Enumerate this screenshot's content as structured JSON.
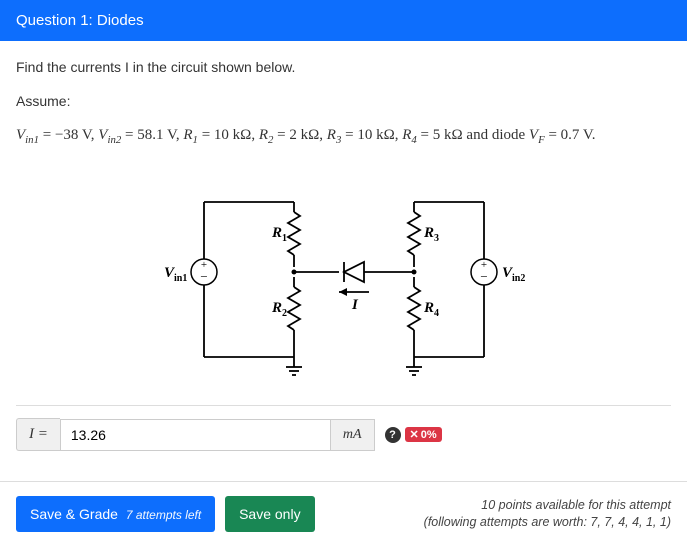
{
  "header": {
    "title": "Question 1: Diodes"
  },
  "prompt": "Find the currents I in the circuit shown below.",
  "assume_label": "Assume:",
  "params": {
    "Vin1": "−38 V",
    "Vin2": "58.1 V",
    "R1": "10 kΩ",
    "R2": "2 kΩ",
    "R3": "10 kΩ",
    "R4": "5 kΩ",
    "VF": "0.7 V",
    "and_diode": " and diode "
  },
  "circuit_labels": {
    "Vin1": "Vin1",
    "Vin2": "Vin2",
    "R1": "R1",
    "R2": "R2",
    "R3": "R3",
    "R4": "R4",
    "I": "I"
  },
  "answer": {
    "var": "I =",
    "value": "13.26",
    "unit": "mA",
    "help_icon": "?",
    "badge_icon": "✕",
    "badge_text": "0%"
  },
  "footer": {
    "save_grade": "Save & Grade",
    "attempts": "7 attempts left",
    "save_only": "Save only",
    "points_line": "10 points available for this attempt",
    "following_line": "(following attempts are worth: 7, 7, 4, 4, 1, 1)"
  }
}
